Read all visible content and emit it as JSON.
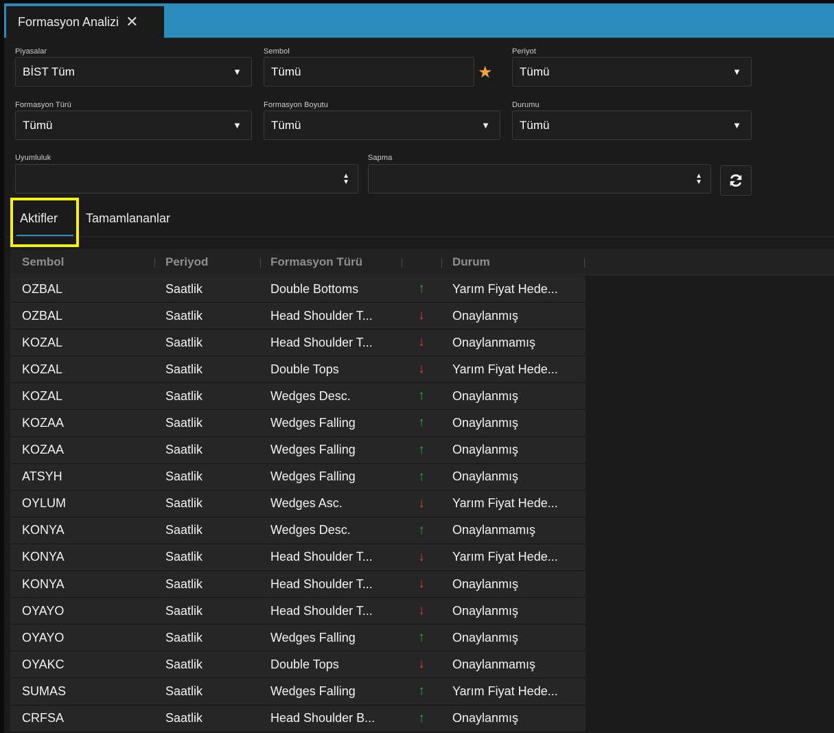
{
  "tab": {
    "title": "Formasyon Analizi",
    "close_label": "✕"
  },
  "filters": {
    "piyasalar": {
      "label": "Piyasalar",
      "value": "BİST Tüm"
    },
    "sembol": {
      "label": "Sembol",
      "value": "Tümü"
    },
    "periyot": {
      "label": "Periyot",
      "value": "Tümü"
    },
    "formasyon_turu": {
      "label": "Formasyon Türü",
      "value": "Tümü"
    },
    "formasyon_boyutu": {
      "label": "Formasyon Boyutu",
      "value": "Tümü"
    },
    "durumu": {
      "label": "Durumu",
      "value": "Tümü"
    },
    "uyumluluk": {
      "label": "Uyumluluk",
      "value": ""
    },
    "sapma": {
      "label": "Sapma",
      "value": ""
    }
  },
  "subtabs": [
    {
      "label": "Aktifler",
      "active": true
    },
    {
      "label": "Tamamlananlar",
      "active": false
    }
  ],
  "table": {
    "columns": [
      "Sembol",
      "Periyod",
      "Formasyon Türü",
      "Durum"
    ],
    "rows": [
      {
        "sembol": "OZBAL",
        "periyod": "Saatlik",
        "tur": "Double Bottoms",
        "yon": "up",
        "durum": "Yarım Fiyat Hede..."
      },
      {
        "sembol": "OZBAL",
        "periyod": "Saatlik",
        "tur": "Head Shoulder T...",
        "yon": "down",
        "durum": "Onaylanmış"
      },
      {
        "sembol": "KOZAL",
        "periyod": "Saatlik",
        "tur": "Head Shoulder T...",
        "yon": "down",
        "durum": "Onaylanmamış"
      },
      {
        "sembol": "KOZAL",
        "periyod": "Saatlik",
        "tur": "Double Tops",
        "yon": "down",
        "durum": "Yarım Fiyat Hede..."
      },
      {
        "sembol": "KOZAL",
        "periyod": "Saatlik",
        "tur": "Wedges Desc.",
        "yon": "up",
        "durum": "Onaylanmış"
      },
      {
        "sembol": "KOZAA",
        "periyod": "Saatlik",
        "tur": "Wedges Falling",
        "yon": "up",
        "durum": "Onaylanmış"
      },
      {
        "sembol": "KOZAA",
        "periyod": "Saatlik",
        "tur": "Wedges Falling",
        "yon": "up",
        "durum": "Onaylanmış"
      },
      {
        "sembol": "ATSYH",
        "periyod": "Saatlik",
        "tur": "Wedges Falling",
        "yon": "up",
        "durum": "Onaylanmış"
      },
      {
        "sembol": "OYLUM",
        "periyod": "Saatlik",
        "tur": "Wedges Asc.",
        "yon": "down",
        "durum": "Yarım Fiyat Hede..."
      },
      {
        "sembol": "KONYA",
        "periyod": "Saatlik",
        "tur": "Wedges Desc.",
        "yon": "up",
        "durum": "Onaylanmamış"
      },
      {
        "sembol": "KONYA",
        "periyod": "Saatlik",
        "tur": "Head Shoulder T...",
        "yon": "down",
        "durum": "Yarım Fiyat Hede..."
      },
      {
        "sembol": "KONYA",
        "periyod": "Saatlik",
        "tur": "Head Shoulder T...",
        "yon": "down",
        "durum": "Onaylanmış"
      },
      {
        "sembol": "OYAYO",
        "periyod": "Saatlik",
        "tur": "Head Shoulder T...",
        "yon": "down",
        "durum": "Onaylanmış"
      },
      {
        "sembol": "OYAYO",
        "periyod": "Saatlik",
        "tur": "Wedges Falling",
        "yon": "up",
        "durum": "Onaylanmış"
      },
      {
        "sembol": "OYAKC",
        "periyod": "Saatlik",
        "tur": "Double Tops",
        "yon": "down",
        "durum": "Onaylanmamış"
      },
      {
        "sembol": "SUMAS",
        "periyod": "Saatlik",
        "tur": "Wedges Falling",
        "yon": "up",
        "durum": "Yarım Fiyat Hede..."
      },
      {
        "sembol": "CRFSA",
        "periyod": "Saatlik",
        "tur": "Head Shoulder B...",
        "yon": "up",
        "durum": "Onaylanmış"
      }
    ]
  },
  "icons": {
    "dropdown": "caret-down-icon",
    "favorite": "star-icon",
    "spinner": "spinner-arrows-icon",
    "refresh": "refresh-icon",
    "trend_up": "arrow-up-icon",
    "trend_down": "arrow-down-icon"
  },
  "colors": {
    "accent": "#2b8bbd",
    "highlight": "#f6f20e",
    "star": "#f0a43a",
    "up": "#2ea84a",
    "down": "#e23d3d"
  }
}
